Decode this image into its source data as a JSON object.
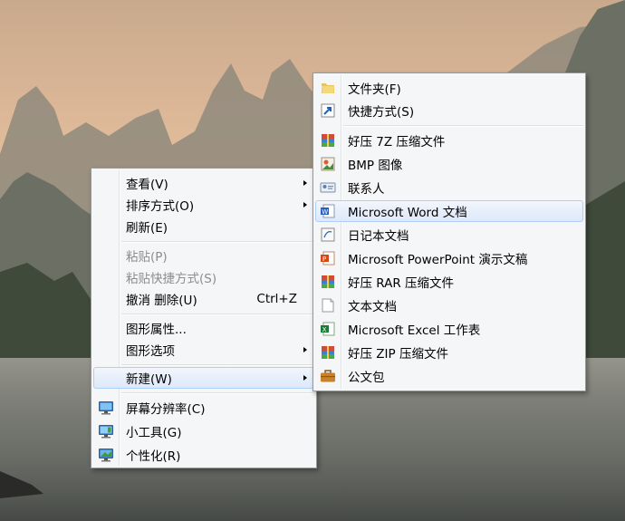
{
  "context_menu": {
    "items": [
      {
        "label": "查看(V)",
        "submenu": true
      },
      {
        "label": "排序方式(O)",
        "submenu": true
      },
      {
        "label": "刷新(E)"
      },
      {
        "label": "粘贴(P)",
        "disabled": true
      },
      {
        "label": "粘贴快捷方式(S)",
        "disabled": true
      },
      {
        "label": "撤消 删除(U)",
        "shortcut": "Ctrl+Z"
      },
      {
        "label": "图形属性..."
      },
      {
        "label": "图形选项",
        "submenu": true
      },
      {
        "label": "新建(W)",
        "submenu": true,
        "highlighted": true
      },
      {
        "label": "屏幕分辨率(C)",
        "icon": "display-icon"
      },
      {
        "label": "小工具(G)",
        "icon": "gadgets-icon"
      },
      {
        "label": "个性化(R)",
        "icon": "personalize-icon"
      }
    ]
  },
  "new_submenu": {
    "items": [
      {
        "label": "文件夹(F)",
        "icon": "folder-icon"
      },
      {
        "label": "快捷方式(S)",
        "icon": "shortcut-icon"
      },
      {
        "label": "好压 7Z 压缩文件",
        "icon": "archive-icon"
      },
      {
        "label": "BMP 图像",
        "icon": "bmp-image-icon"
      },
      {
        "label": "联系人",
        "icon": "contact-icon"
      },
      {
        "label": "Microsoft Word 文档",
        "icon": "word-document-icon",
        "highlighted": true
      },
      {
        "label": "日记本文档",
        "icon": "journal-icon"
      },
      {
        "label": "Microsoft PowerPoint 演示文稿",
        "icon": "powerpoint-icon"
      },
      {
        "label": "好压 RAR 压缩文件",
        "icon": "archive-icon"
      },
      {
        "label": "文本文档",
        "icon": "text-document-icon"
      },
      {
        "label": "Microsoft Excel 工作表",
        "icon": "excel-icon"
      },
      {
        "label": "好压 ZIP 压缩文件",
        "icon": "archive-icon"
      },
      {
        "label": "公文包",
        "icon": "briefcase-icon"
      }
    ]
  }
}
